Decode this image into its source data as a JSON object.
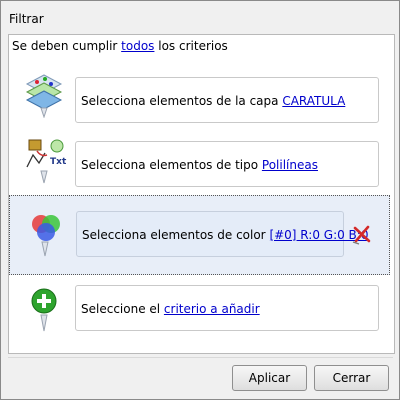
{
  "window": {
    "title": "Filtrar"
  },
  "header": {
    "prefix": "Se deben cumplir ",
    "link": "todos",
    "suffix": " los criterios"
  },
  "criteria": [
    {
      "icon": "layers-icon",
      "text": "Selecciona elementos de la capa ",
      "link": "CARATULA"
    },
    {
      "icon": "shapes-type-icon",
      "text": "Selecciona elementos de tipo ",
      "link": "Polilíneas"
    },
    {
      "icon": "color-rgb-icon",
      "text": "Selecciona elementos de color ",
      "link": "[#0] R:0 G:0 B:0",
      "selected": true
    },
    {
      "icon": "add-criterion-icon",
      "text": "Seleccione el ",
      "link": "criterio a añadir"
    }
  ],
  "buttons": {
    "apply": "Aplicar",
    "close": "Cerrar"
  },
  "colors": {
    "selection_bg": "#e8eef8",
    "link": "#0000cc",
    "add_green": "#2ea42e",
    "delete_red": "#d42a2a"
  }
}
